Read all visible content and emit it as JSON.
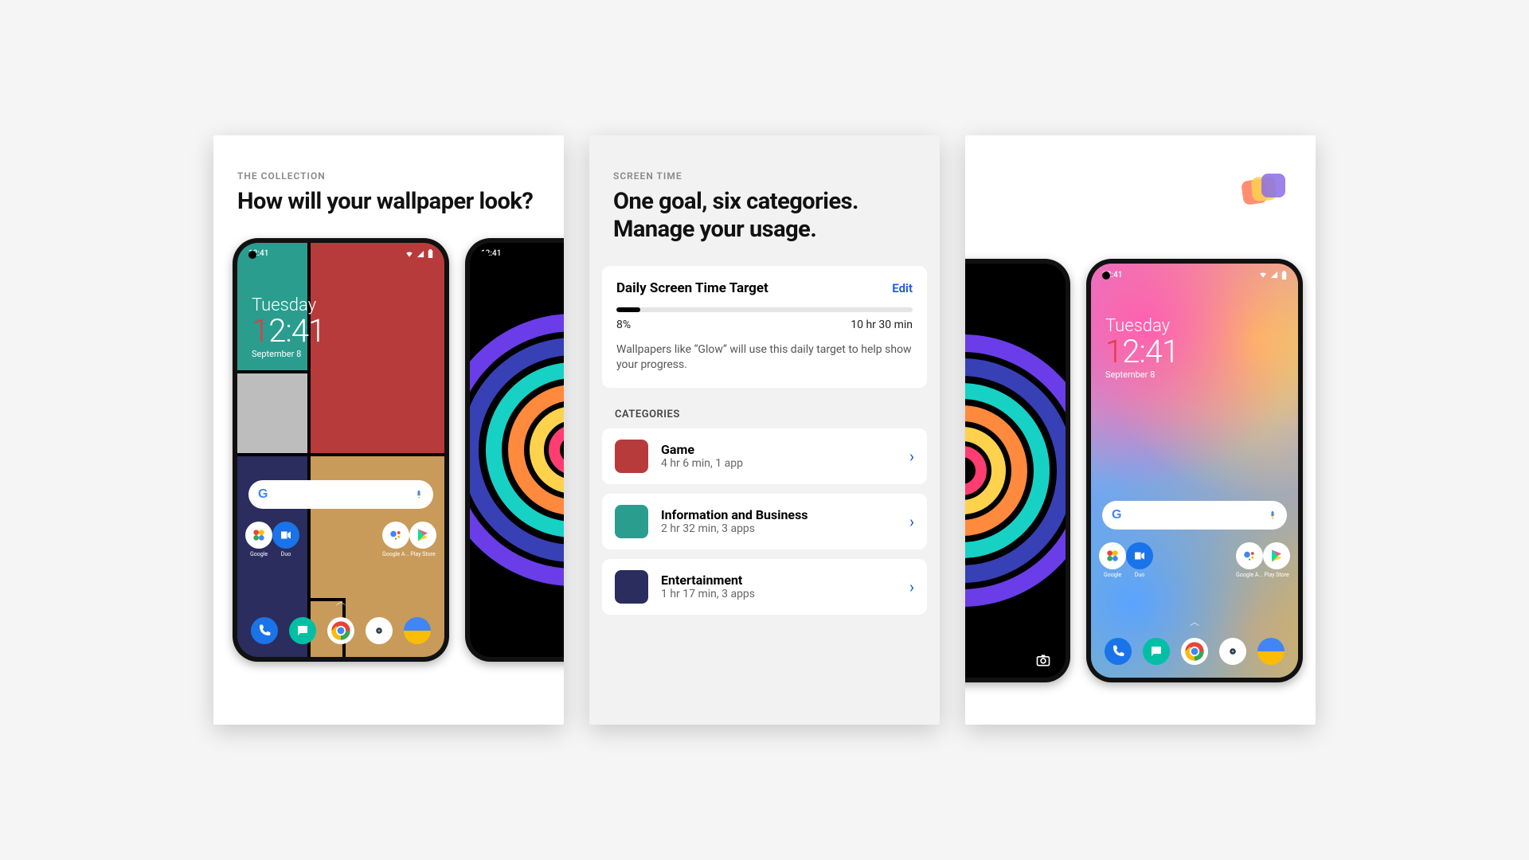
{
  "panel1": {
    "eyebrow": "THE COLLECTION",
    "headline": "How will your wallpaper look?",
    "clock": {
      "day": "Tuesday",
      "hour1": "1",
      "rest": "2:41",
      "date": "September 8"
    },
    "statusTime": "12:41",
    "apps": {
      "google": "Google",
      "duo": "Duo",
      "assistant": "Google A...",
      "play": "Play Store"
    }
  },
  "panel2": {
    "eyebrow": "SCREEN TIME",
    "headline": "One goal, six categories. Manage your usage.",
    "target": {
      "title": "Daily Screen Time Target",
      "edit": "Edit",
      "percent": "8%",
      "duration": "10 hr 30 min",
      "percentValue": 8,
      "desc": "Wallpapers like “Glow” will use this daily target to help show your progress."
    },
    "categoriesLabel": "CATEGORIES",
    "categories": [
      {
        "name": "Game",
        "sub": "4 hr 6 min, 1 app",
        "color": "#b83b3b"
      },
      {
        "name": "Information and Business",
        "sub": "2 hr 32 min, 3 apps",
        "color": "#2a9d8f"
      },
      {
        "name": "Entertainment",
        "sub": "1 hr 17 min, 3 apps",
        "color": "#2b2d5e"
      }
    ]
  },
  "panel3": {
    "clock": {
      "day": "Tuesday",
      "hour1": "1",
      "rest": "2:41",
      "date": "September 8"
    },
    "statusTime": "12:41",
    "apps": {
      "google": "Google",
      "duo": "Duo",
      "assistant": "Google A...",
      "play": "Play Store"
    }
  }
}
